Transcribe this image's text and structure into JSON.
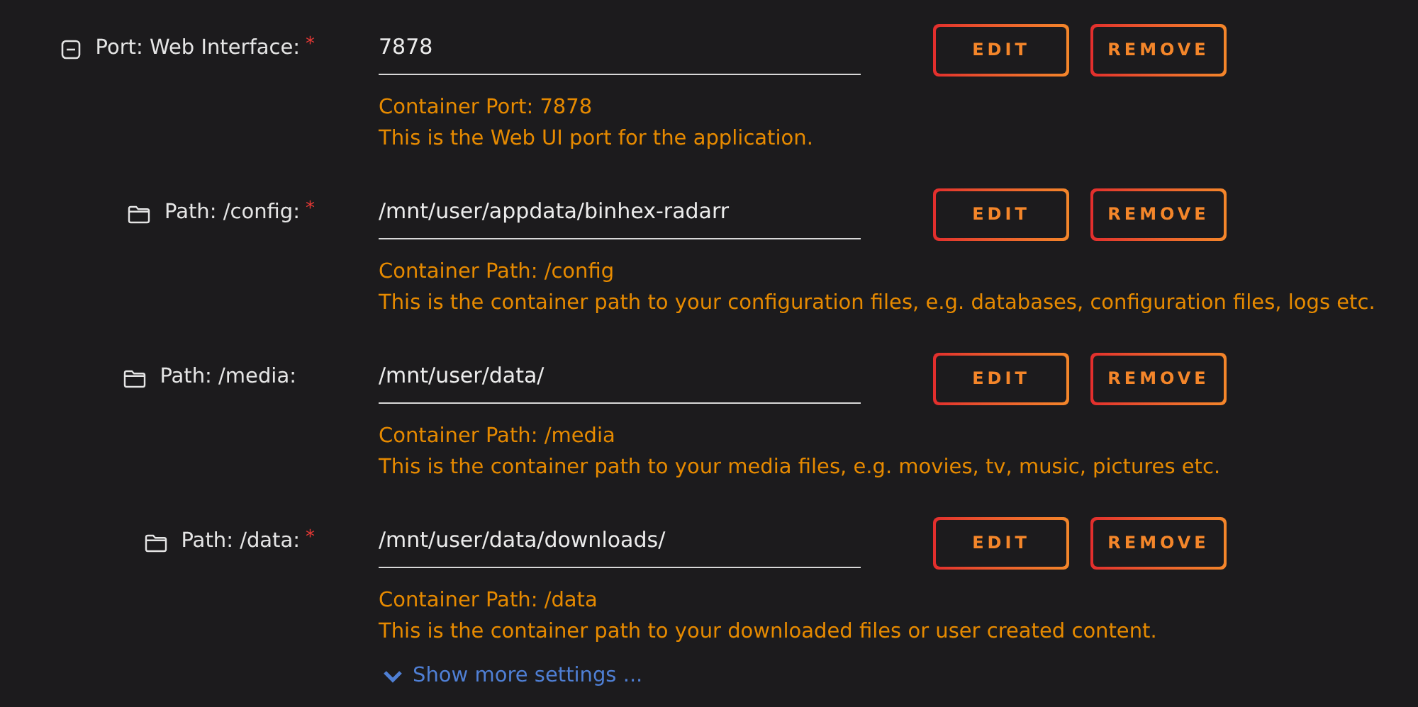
{
  "settings": [
    {
      "kind": "collapse",
      "label": "Port: Web Interface:",
      "required_mark": "*",
      "value": "7878",
      "container": "Container Port: 7878",
      "description": "This is the Web UI port for the application.",
      "buttons": [
        "EDIT",
        "REMOVE"
      ]
    },
    {
      "kind": "folder",
      "label": "Path: /config:",
      "required_mark": "*",
      "value": "/mnt/user/appdata/binhex-radarr",
      "container": "Container Path: /config",
      "description": "This is the container path to your configuration files, e.g. databases, configuration files, logs etc.",
      "buttons": [
        "EDIT",
        "REMOVE"
      ]
    },
    {
      "kind": "folder",
      "label": "Path: /media:",
      "value": "/mnt/user/data/",
      "container": "Container Path: /media",
      "description": "This is the container path to your media files, e.g. movies, tv, music, pictures etc.",
      "buttons": [
        "EDIT",
        "REMOVE"
      ]
    },
    {
      "kind": "folder",
      "label": "Path: /data:",
      "required_mark": "*",
      "value": "/mnt/user/data/downloads/",
      "container": "Container Path: /data",
      "description": "This is the container path to your downloaded files or user created content.",
      "buttons": [
        "EDIT",
        "REMOVE"
      ]
    }
  ],
  "show_more": "Show more settings ..."
}
